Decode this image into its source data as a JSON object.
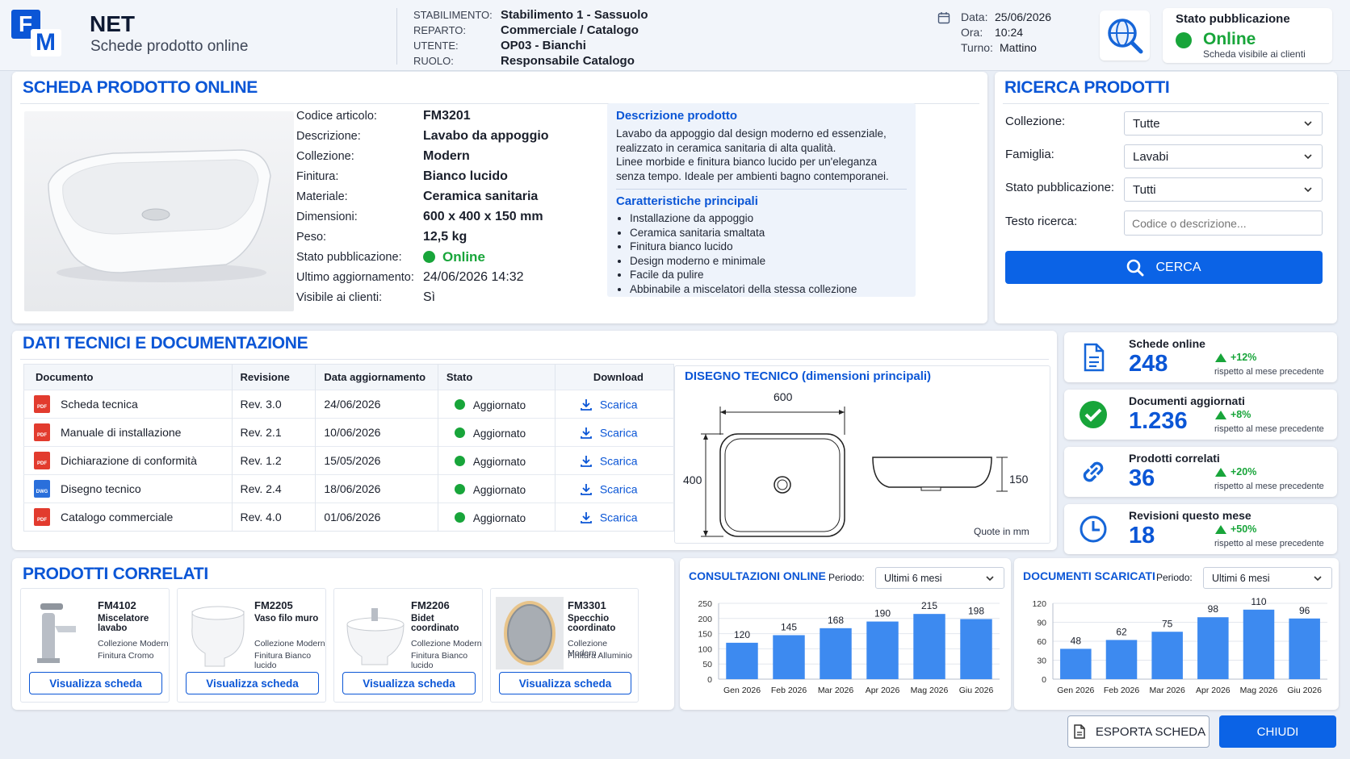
{
  "header": {
    "logo": {
      "letter1": "F",
      "letter2": "M"
    },
    "app_title": "NET",
    "app_subtitle": "Schede prodotto online",
    "info": [
      {
        "label": "STABILIMENTO:",
        "value": "Stabilimento 1 - Sassuolo"
      },
      {
        "label": "REPARTO:",
        "value": "Commerciale / Catalogo"
      },
      {
        "label": "UTENTE:",
        "value": "OP03 - Bianchi"
      },
      {
        "label": "RUOLO:",
        "value": "Responsabile Catalogo"
      }
    ],
    "date": {
      "label": "Data:",
      "value": "25/06/2026"
    },
    "time": {
      "label": "Ora:",
      "value": "10:24"
    },
    "shift": {
      "label": "Turno:",
      "value": "Mattino"
    },
    "status": {
      "title": "Stato pubblicazione",
      "value": "Online",
      "note": "Scheda visibile ai clienti"
    }
  },
  "product": {
    "title": "SCHEDA PRODOTTO ONLINE",
    "fields": [
      {
        "label": "Codice articolo:",
        "value": "FM3201"
      },
      {
        "label": "Descrizione:",
        "value": "Lavabo da appoggio"
      },
      {
        "label": "Collezione:",
        "value": "Modern"
      },
      {
        "label": "Finitura:",
        "value": "Bianco lucido"
      },
      {
        "label": "Materiale:",
        "value": "Ceramica sanitaria"
      },
      {
        "label": "Dimensioni:",
        "value": "600 x 400 x 150 mm"
      },
      {
        "label": "Peso:",
        "value": "12,5 kg"
      },
      {
        "label": "Stato pubblicazione:",
        "value": "Online"
      },
      {
        "label": "Ultimo aggiornamento:",
        "value": "24/06/2026 14:32"
      },
      {
        "label": "Visibile ai clienti:",
        "value": "Sì"
      }
    ],
    "desc_title": "Descrizione prodotto",
    "desc_lines": [
      "Lavabo da appoggio dal design moderno ed essenziale,",
      "realizzato in ceramica sanitaria di alta qualità.",
      "Linee morbide e finitura bianco lucido per un'eleganza",
      "senza tempo. Ideale per ambienti bagno contemporanei."
    ],
    "features_title": "Caratteristiche principali",
    "features": [
      "Installazione da appoggio",
      "Ceramica sanitaria smaltata",
      "Finitura bianco lucido",
      "Design moderno e minimale",
      "Facile da pulire",
      "Abbinabile a miscelatori della stessa collezione"
    ]
  },
  "search": {
    "title": "RICERCA PRODOTTI",
    "collezione": {
      "label": "Collezione:",
      "value": "Tutte"
    },
    "famiglia": {
      "label": "Famiglia:",
      "value": "Lavabi"
    },
    "stato": {
      "label": "Stato pubblicazione:",
      "value": "Tutti"
    },
    "testo": {
      "label": "Testo ricerca:",
      "placeholder": "Codice o descrizione..."
    },
    "button": "CERCA"
  },
  "docs": {
    "title": "DATI TECNICI E DOCUMENTAZIONE",
    "headers": [
      "Documento",
      "Revisione",
      "Data aggiornamento",
      "Stato",
      "Download"
    ],
    "rows": [
      {
        "type": "PDF",
        "name": "Scheda tecnica",
        "rev": "Rev. 3.0",
        "date": "24/06/2026",
        "status": "Aggiornato",
        "dl": "Scarica"
      },
      {
        "type": "PDF",
        "name": "Manuale di installazione",
        "rev": "Rev. 2.1",
        "date": "10/06/2026",
        "status": "Aggiornato",
        "dl": "Scarica"
      },
      {
        "type": "PDF",
        "name": "Dichiarazione di conformità",
        "rev": "Rev. 1.2",
        "date": "15/05/2026",
        "status": "Aggiornato",
        "dl": "Scarica"
      },
      {
        "type": "DWG",
        "name": "Disegno tecnico",
        "rev": "Rev. 2.4",
        "date": "18/06/2026",
        "status": "Aggiornato",
        "dl": "Scarica"
      },
      {
        "type": "PDF",
        "name": "Catalogo commerciale",
        "rev": "Rev. 4.0",
        "date": "01/06/2026",
        "status": "Aggiornato",
        "dl": "Scarica"
      }
    ],
    "drawing": {
      "title": "DISEGNO TECNICO (dimensioni principali)",
      "width": "600",
      "depth": "400",
      "height": "150",
      "note": "Quote in mm"
    }
  },
  "kpis": [
    {
      "icon": "document-icon",
      "title": "Schede online",
      "value": "248",
      "delta": "+12%",
      "note": "rispetto al mese precedente"
    },
    {
      "icon": "check-circle-icon",
      "title": "Documenti aggiornati",
      "value": "1.236",
      "delta": "+8%",
      "note": "rispetto al mese precedente"
    },
    {
      "icon": "link-icon",
      "title": "Prodotti correlati",
      "value": "36",
      "delta": "+20%",
      "note": "rispetto al mese precedente"
    },
    {
      "icon": "clock-icon",
      "title": "Revisioni questo mese",
      "value": "18",
      "delta": "+50%",
      "note": "rispetto al mese precedente"
    }
  ],
  "related": {
    "title": "PRODOTTI CORRELATI",
    "items": [
      {
        "code": "FM4102",
        "name": "Miscelatore lavabo",
        "line1": "Collezione Modern",
        "line2": "Finitura Cromo",
        "button": "Visualizza scheda",
        "icon": "faucet-icon"
      },
      {
        "code": "FM2205",
        "name": "Vaso filo muro",
        "line1": "Collezione Modern",
        "line2": "Finitura Bianco lucido",
        "button": "Visualizza scheda",
        "icon": "toilet-icon"
      },
      {
        "code": "FM2206",
        "name": "Bidet coordinato",
        "line1": "Collezione Modern",
        "line2": "Finitura Bianco lucido",
        "button": "Visualizza scheda",
        "icon": "bidet-icon"
      },
      {
        "code": "FM3301",
        "name": "Specchio coordinato",
        "line1": "Collezione Modern",
        "line2": "Finitura Alluminio",
        "button": "Visualizza scheda",
        "icon": "mirror-icon"
      }
    ]
  },
  "chart_data": [
    {
      "type": "bar",
      "title": "CONSULTAZIONI ONLINE",
      "period_label": "Periodo:",
      "period": "Ultimi 6 mesi",
      "categories": [
        "Gen 2026",
        "Feb 2026",
        "Mar 2026",
        "Apr 2026",
        "Mag 2026",
        "Giu 2026"
      ],
      "values": [
        120,
        145,
        168,
        190,
        215,
        198
      ],
      "yticks": [
        0,
        50,
        100,
        150,
        200,
        250
      ],
      "ylim": [
        0,
        250
      ],
      "grid": true,
      "color": "#3d8af0"
    },
    {
      "type": "bar",
      "title": "DOCUMENTI SCARICATI",
      "period_label": "Periodo:",
      "period": "Ultimi 6 mesi",
      "categories": [
        "Gen 2026",
        "Feb 2026",
        "Mar 2026",
        "Apr 2026",
        "Mag 2026",
        "Giu 2026"
      ],
      "values": [
        48,
        62,
        75,
        98,
        110,
        96
      ],
      "yticks": [
        0,
        30,
        60,
        90,
        120
      ],
      "ylim": [
        0,
        120
      ],
      "grid": true,
      "color": "#3d8af0"
    }
  ],
  "footer": {
    "export": "ESPORTA SCHEDA",
    "close": "CHIUDI"
  }
}
